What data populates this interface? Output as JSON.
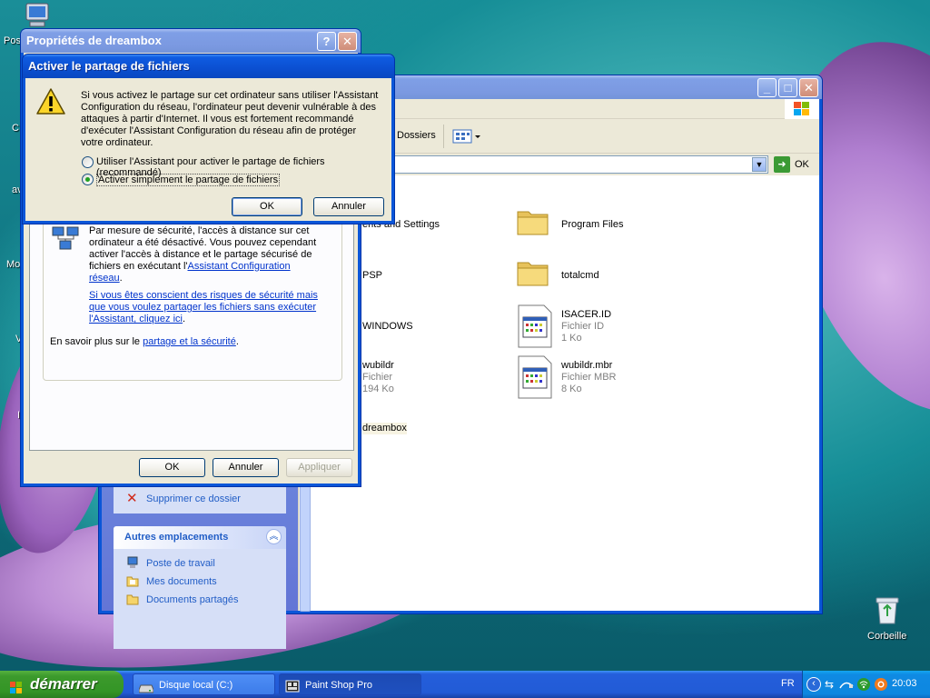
{
  "desktop": {
    "icons": {
      "computer": "Pos",
      "recycle": "Corbeille"
    },
    "edge_labels": [
      "C",
      "av",
      "Mo",
      "V",
      "I"
    ]
  },
  "properties_window": {
    "title": "Propriétés de dreambox",
    "help_glyph": "?",
    "close_glyph": "✕",
    "body_text": "Par mesure de sécurité, l'accès à distance sur cet ordinateur a été désactivé. Vous pouvez cependant activer l'accès à distance et le partage sécurisé de fichiers en exécutant l'",
    "body_link": "Assistant Configuration réseau",
    "body_end": ".",
    "risk_link": "Si vous êtes conscient des risques de sécurité mais que vous voulez partager les fichiers sans exécuter l'Assistant, cliquez ici",
    "risk_end": ".",
    "learn_prefix": "En savoir plus sur le ",
    "learn_link": "partage et la sécurité",
    "learn_end": ".",
    "ok": "OK",
    "cancel": "Annuler",
    "apply": "Appliquer"
  },
  "dialog": {
    "title": "Activer le partage de fichiers",
    "message": "Si vous activez le partage sur cet ordinateur sans utiliser l'Assistant Configuration du réseau, l'ordinateur peut devenir vulnérable à des attaques à partir d'Internet. Il vous est fortement recommandé d'exécuter l'Assistant Configuration du réseau afin de protéger votre ordinateur.",
    "option1": "Utiliser l'Assistant pour activer le partage de fichiers (recommandé)",
    "option2": "Activer simplement le partage de fichiers",
    "selected_option": 2,
    "ok": "OK",
    "cancel": "Annuler"
  },
  "explorer": {
    "toolbar_folders": "Dossiers",
    "address_go": "OK",
    "sidebar": {
      "delete_folder": "Supprimer ce dossier",
      "other_places_title": "Autres emplacements",
      "places": [
        "Poste de travail",
        "Mes documents",
        "Documents partagés"
      ]
    },
    "files_left": [
      {
        "name": "ents and Settings",
        "type": "",
        "size": ""
      },
      {
        "name": "PSP",
        "type": "",
        "size": ""
      },
      {
        "name": "WINDOWS",
        "type": "",
        "size": ""
      },
      {
        "name": "wubildr",
        "type": "Fichier",
        "size": "194 Ko"
      },
      {
        "name": "dreambox",
        "type": "",
        "size": ""
      }
    ],
    "files_right": [
      {
        "name": "Program Files",
        "type": "",
        "size": ""
      },
      {
        "name": "totalcmd",
        "type": "",
        "size": ""
      },
      {
        "name": "ISACER.ID",
        "type": "Fichier ID",
        "size": "1 Ko"
      },
      {
        "name": "wubildr.mbr",
        "type": "Fichier MBR",
        "size": "8 Ko"
      }
    ]
  },
  "taskbar": {
    "start": "démarrer",
    "tasks": [
      "Disque local (C:)",
      "Paint Shop Pro"
    ],
    "lang": "FR",
    "clock": "20:03"
  },
  "colors": {
    "xp_blue": "#0a56d8",
    "dialog_bg": "#ece9d8",
    "link": "#0033cc",
    "start_green": "#3c9a2c"
  }
}
